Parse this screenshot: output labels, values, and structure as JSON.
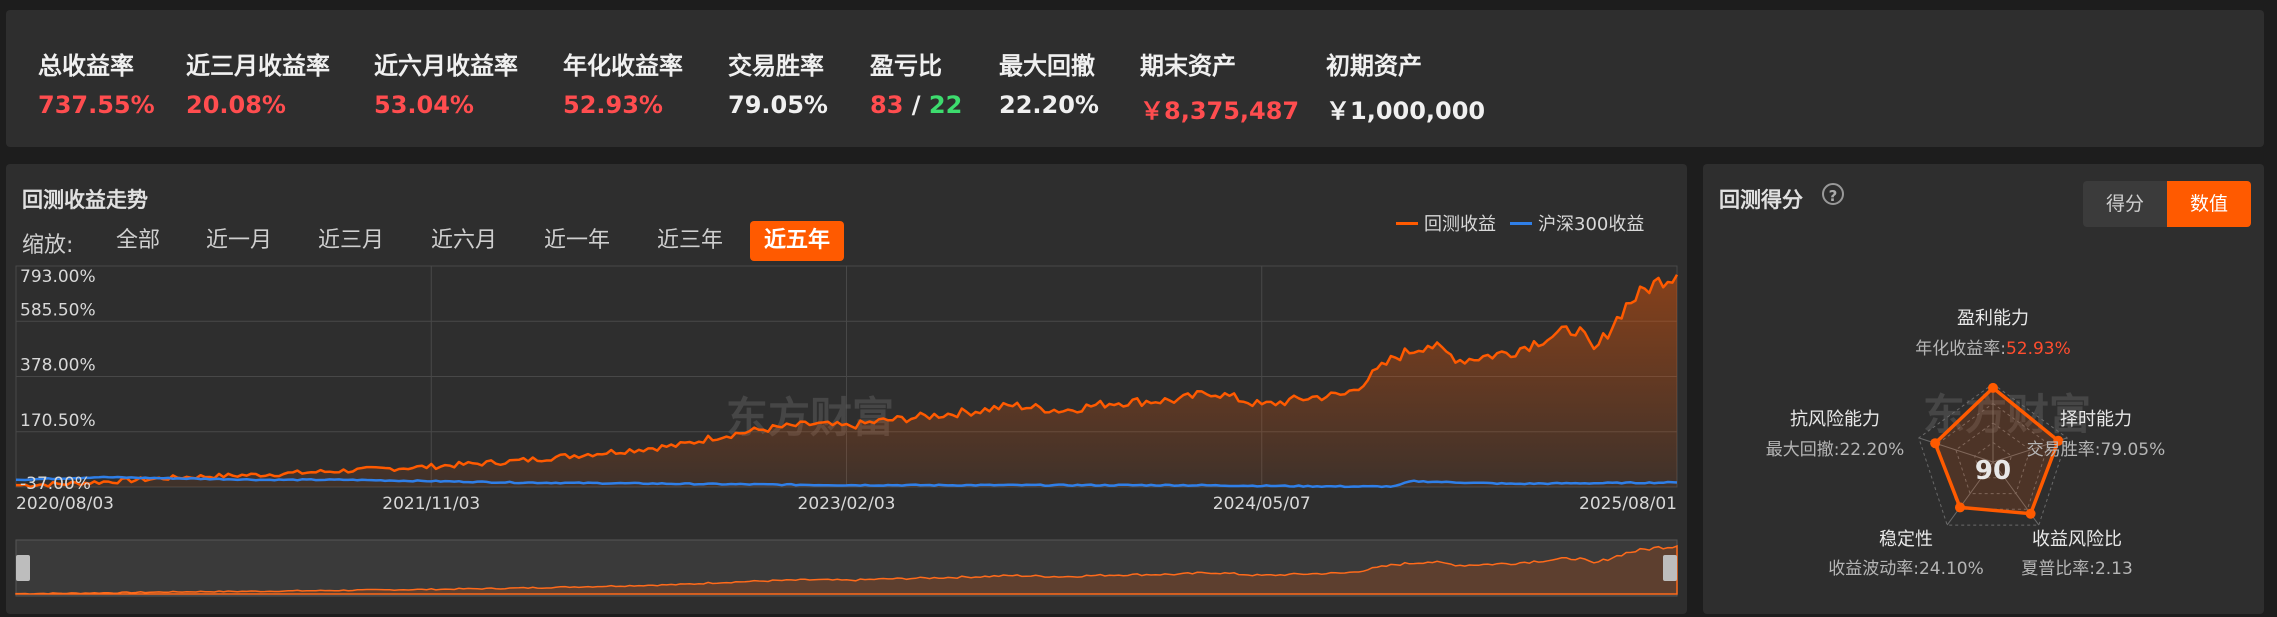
{
  "stats": [
    {
      "label": "总收益率",
      "value": "737.55%",
      "color": "red"
    },
    {
      "label": "近三月收益率",
      "value": "20.08%",
      "color": "red"
    },
    {
      "label": "近六月收益率",
      "value": "53.04%",
      "color": "red"
    },
    {
      "label": "年化收益率",
      "value": "52.93%",
      "color": "red"
    },
    {
      "label": "交易胜率",
      "value": "79.05%",
      "color": "white"
    },
    {
      "label": "盈亏比",
      "win": "83",
      "sep": "/",
      "loss": "22"
    },
    {
      "label": "最大回撤",
      "value": "22.20%",
      "color": "white"
    },
    {
      "label": "期末资产",
      "value": "￥8,375,487",
      "color": "red"
    },
    {
      "label": "初期资产",
      "value": "￥1,000,000",
      "color": "white"
    }
  ],
  "chart_panel": {
    "title": "回测收益走势",
    "zoom_label": "缩放:",
    "ranges": [
      "全部",
      "近一月",
      "近三月",
      "近六月",
      "近一年",
      "近三年",
      "近五年"
    ],
    "active_range": "近五年",
    "watermark": "东方财富"
  },
  "chart_data": {
    "type": "area",
    "x_start": "2020/08/03",
    "x_end": "2025/08/01",
    "x_ticks": [
      "2020/08/03",
      "2021/11/03",
      "2023/02/03",
      "2024/05/07",
      "2025/08/01"
    ],
    "y_ticks": [
      "793.00%",
      "585.50%",
      "378.00%",
      "170.50%",
      "-37.00%"
    ],
    "ylim": [
      -37,
      793
    ],
    "grid": true,
    "legend_position": "top-right",
    "series": [
      {
        "name": "回测收益",
        "color": "#ff5a00",
        "fill": true,
        "x": [
          0,
          0.03,
          0.06,
          0.1,
          0.15,
          0.2,
          0.25,
          0.3,
          0.35,
          0.4,
          0.42,
          0.45,
          0.48,
          0.5,
          0.52,
          0.55,
          0.58,
          0.6,
          0.63,
          0.66,
          0.7,
          0.72,
          0.75,
          0.78,
          0.8,
          0.81,
          0.83,
          0.85,
          0.87,
          0.9,
          0.92,
          0.94,
          0.95,
          0.96,
          0.97,
          0.98,
          0.99,
          1.0
        ],
        "values": [
          -30,
          -25,
          -15,
          0,
          10,
          25,
          40,
          60,
          90,
          120,
          150,
          180,
          200,
          190,
          210,
          230,
          250,
          270,
          250,
          280,
          290,
          320,
          270,
          300,
          310,
          350,
          450,
          500,
          440,
          470,
          520,
          560,
          470,
          560,
          650,
          700,
          740,
          760
        ]
      },
      {
        "name": "沪深300收益",
        "color": "#2f7fe8",
        "fill": false,
        "x": [
          0,
          0.05,
          0.1,
          0.15,
          0.2,
          0.3,
          0.4,
          0.5,
          0.6,
          0.7,
          0.8,
          0.83,
          0.84,
          0.9,
          1.0
        ],
        "values": [
          -10,
          0,
          -5,
          -10,
          -10,
          -20,
          -25,
          -30,
          -30,
          -30,
          -35,
          -35,
          -15,
          -25,
          -20
        ]
      }
    ]
  },
  "score_panel": {
    "title": "回测得分",
    "help_icon": "question-circle-icon",
    "toggle": [
      "得分",
      "数值"
    ],
    "active_toggle": "数值",
    "score": "90",
    "watermark": "东方财富",
    "dimensions": [
      {
        "name": "盈利能力",
        "metric": "年化收益率:",
        "value": "52.93%",
        "score": 0.95,
        "highlight": true
      },
      {
        "name": "择时能力",
        "metric": "交易胜率:",
        "value": "79.05%",
        "score": 0.88
      },
      {
        "name": "收益风险比",
        "metric": "夏普比率:",
        "value": "2.13",
        "score": 0.82
      },
      {
        "name": "稳定性",
        "metric": "收益波动率:",
        "value": "24.10%",
        "score": 0.72
      },
      {
        "name": "抗风险能力",
        "metric": "最大回撤:",
        "value": "22.20%",
        "score": 0.78
      }
    ]
  },
  "colors": {
    "accent": "#ff5a00",
    "benchmark": "#2f7fe8",
    "up": "#ff4d4f",
    "down": "#3ddc6e"
  }
}
